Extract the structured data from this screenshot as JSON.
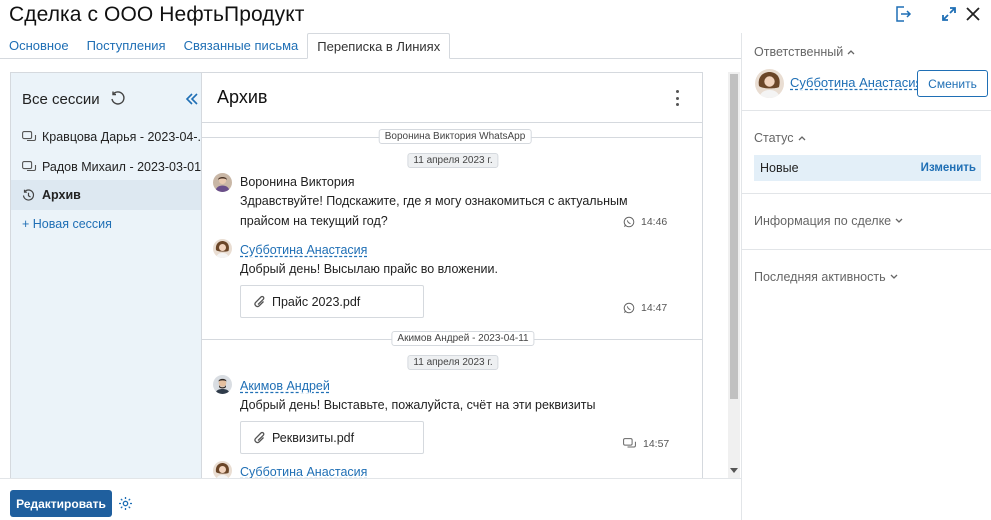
{
  "header": {
    "title": "Сделка с ООО НефтьПродукт"
  },
  "tabs": [
    {
      "label": "Основное"
    },
    {
      "label": "Поступления"
    },
    {
      "label": "Связанные письма"
    },
    {
      "label": "Переписка в Линиях"
    }
  ],
  "sessions": {
    "title": "Все сессии",
    "items": [
      {
        "label": "Кравцова Дарья - 2023-04-..."
      },
      {
        "label": "Радов Михаил - 2023-03-01"
      },
      {
        "label": "Архив"
      }
    ],
    "new_session_label": "+ Новая сессия"
  },
  "chat": {
    "title": "Архив",
    "blocks": [
      {
        "session_pill": "Воронина Виктория WhatsApp",
        "date_pill": "11 апреля 2023 г.",
        "messages": [
          {
            "author": "Воронина Виктория",
            "text_line1": "Здравствуйте! Подскажите, где я могу ознакомиться с актуальным",
            "text_line2": "прайсом на текущий год?",
            "time": "14:46",
            "channel_icon": "whatsapp-icon"
          },
          {
            "author": "Субботина Анастасия",
            "text_line1": "Добрый день! Высылаю прайс во вложении.",
            "file": "Прайс 2023.pdf",
            "time": "14:47",
            "channel_icon": "whatsapp-icon"
          }
        ]
      },
      {
        "session_pill": "Акимов Андрей - 2023-04-11",
        "date_pill": "11 апреля 2023 г.",
        "messages": [
          {
            "author": "Акимов Андрей",
            "text_line1": "Добрый день! Выставьте, пожалуйста, счёт на эти реквизиты",
            "file": "Реквизиты.pdf",
            "time": "14:57",
            "channel_icon": "chat-icon"
          },
          {
            "author": "Субботина Анастасия"
          }
        ]
      }
    ]
  },
  "footer": {
    "edit_label": "Редактировать"
  },
  "right_panel": {
    "responsible_label": "Ответственный",
    "responsible_name": "Субботина Анастасия",
    "change_label": "Сменить",
    "status_label": "Статус",
    "status_value": "Новые",
    "status_change": "Изменить",
    "deal_info_label": "Информация по сделке",
    "last_activity_label": "Последняя активность"
  },
  "colors": {
    "accent": "#1f6fb5",
    "primary_button": "#1f5f9e",
    "sessions_bg": "#ebf3f9",
    "status_bg": "#e3eff8"
  }
}
